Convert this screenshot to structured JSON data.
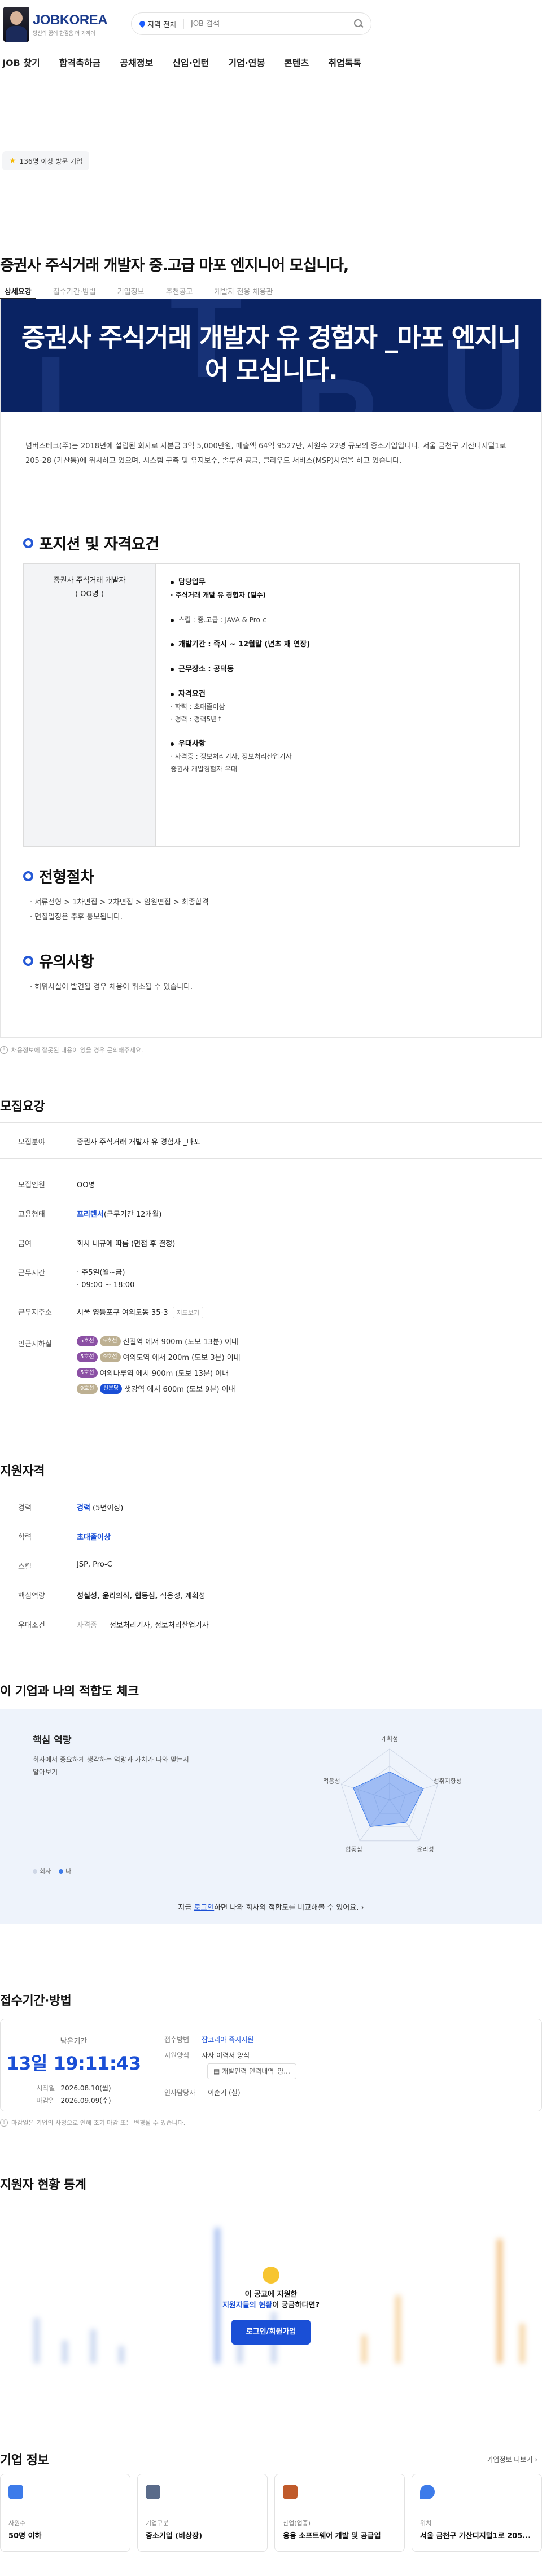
{
  "header": {
    "logo": {
      "title": "JOBKOREA",
      "subtitle": "당신의 꿈에 한걸음 더 가까이"
    },
    "search": {
      "location": "지역 전체",
      "placeholder": "JOB 검색"
    },
    "nav": [
      "JOB 찾기",
      "합격축하금",
      "공채정보",
      "신입·인턴",
      "기업·연봉",
      "콘텐츠",
      "취업톡톡"
    ]
  },
  "badge": {
    "label": "136명 이상 방문 기업"
  },
  "job": {
    "title": "증권사 주식거래 개발자 중.고급 마포 엔지니어 모십니다,",
    "tabs": [
      "상세요강",
      "접수기간·방법",
      "기업정보",
      "추천공고",
      "개발자 전용 채용관"
    ],
    "banner_title": "증권사 주식거래 개발자 유 경험자 _마포 엔지니어 모십니다.",
    "intro": "넘버스테크(주)는 2018년에 설립된 회사로 자본금 3억 5,000만원, 매출액 64억 9527만, 사원수 22명 규모의 중소기업입니다. 서울 금천구 가산디지털1로 205-28 (가산동)에 위치하고 있으며, 시스템 구축 및 유지보수, 솔루션 공급, 클라우드 서비스(MSP)사업을 하고 있습니다."
  },
  "position": {
    "heading": "포지션 및 자격요건",
    "left_title": "증권사 주식거래 개발자",
    "left_count": "( OO명 )",
    "blocks": [
      {
        "head": "담당업무",
        "lines": [
          "· 주식거래 개발 유 경험자 (필수)"
        ]
      },
      {
        "head": "스킬 : 중.고급 : JAVA & Pro-c",
        "lines": []
      },
      {
        "head": "개발기간 : 즉시 ~ 12월말 (년초 재 연장)",
        "lines": []
      },
      {
        "head": "근무장소 : 공덕동",
        "lines": []
      },
      {
        "head": "자격요건",
        "lines": [
          "· 학력 : 초대졸이상",
          "· 경력 : 경력5년↑"
        ]
      },
      {
        "head": "우대사항",
        "lines": [
          "· 자격증 : 정보처리기사, 정보처리산업기사",
          "  증권사 개발경험자 우대"
        ]
      }
    ]
  },
  "process": {
    "heading": "전형절차",
    "lines": [
      "· 서류전형 > 1차면접 > 2차면접 > 임원면접 > 최종합격",
      "· 면접일정은 추후 통보됩니다."
    ]
  },
  "notice": {
    "heading": "유의사항",
    "lines": [
      "· 허위사실이 발견될 경우 채용이 취소될 수 있습니다."
    ]
  },
  "footnote": "채용정보에 잘못된 내용이 있을 경우 문의해주세요.",
  "recruit": {
    "heading": "모집요강",
    "field_label": "모집분야",
    "field": "증권사 주식거래 개발자 유 경험자 _마포",
    "count_label": "모집인원",
    "count": "OO명",
    "type_label": "고용형태",
    "type_main": "프리랜서",
    "type_sub": "(근무기간 12개월)",
    "pay_label": "급여",
    "pay": "회사 내규에 따름 (면접 후 결정)",
    "hours_label": "근무시간",
    "hours": [
      "· 주5일(월~금)",
      "· 09:00 ~ 18:00"
    ],
    "addr_label": "근무지주소",
    "addr": "서울 영등포구 여의도동 35-3",
    "map_btn": "지도보기",
    "station_label": "인근지하철",
    "stations": [
      {
        "lines": [
          "5호선",
          "9호선"
        ],
        "colors": [
          "#8b50a4",
          "#bdb092"
        ],
        "text": "신길역 에서 900m (도보 13분) 이내"
      },
      {
        "lines": [
          "5호선",
          "9호선"
        ],
        "colors": [
          "#8b50a4",
          "#bdb092"
        ],
        "text": "여의도역 에서 200m (도보 3분) 이내"
      },
      {
        "lines": [
          "5호선"
        ],
        "colors": [
          "#8b50a4"
        ],
        "text": "여의나루역 에서 900m (도보 13분) 이내"
      },
      {
        "lines": [
          "9호선",
          "신분당"
        ],
        "colors": [
          "#bdb092",
          "#1a4fd6"
        ],
        "text": "샛강역 에서 600m (도보 9분) 이내"
      }
    ]
  },
  "qual": {
    "heading": "지원자격",
    "rows": [
      {
        "k": "경력",
        "v_blue": "경력",
        "v": " (5년이상)"
      },
      {
        "k": "학력",
        "v_blue": "초대졸이상",
        "v": ""
      },
      {
        "k": "스킬",
        "v_blue": "",
        "v": "JSP, Pro-C"
      },
      {
        "k": "핵심역량",
        "v_bold": "성실성, 윤리의식, 협동심,",
        "v": " 적응성, 계획성"
      },
      {
        "k": "우대조건",
        "v_gray": "자격증",
        "v": "정보처리기사, 정보처리산업기사"
      }
    ]
  },
  "fit": {
    "heading": "이 기업과 나의 적합도 체크",
    "card_title": "핵심 역량",
    "desc": "회사에서 중요하게 생각하는 역량과 가치가 나와 맞는지 알아보기",
    "axes": [
      "계획성",
      "성취지향성",
      "윤리성",
      "협동심",
      "적응성"
    ],
    "values_company": [
      0.55,
      0.7,
      0.55,
      0.65,
      0.75
    ],
    "legend": [
      "회사",
      "나"
    ],
    "cta_pre": "지금 ",
    "cta_link": "로그인",
    "cta_post": "하면 나와 회사의 적합도를 비교해볼 수 있어요."
  },
  "receipt": {
    "heading": "접수기간·방법",
    "remain_label": "남은기간",
    "remain": "13일 19:11:43",
    "start_label": "시작일",
    "start": "2026.08.10(월)",
    "end_label": "마감일",
    "end": "2026.09.09(수)",
    "method_label": "접수방법",
    "method": "잡코리아 즉시지원",
    "form_label": "지원양식",
    "form": "자사 이력서 양식",
    "file_btn": "개발인력 인력내역_양...",
    "manager_label": "인사담당자",
    "manager": "이순기 (실)",
    "note": "마감일은 기업의 사정으로 인해 조기 마감 또는 변경될 수 있습니다."
  },
  "stats": {
    "heading": "지원자 현황 통계",
    "overlay_line1": "이 공고에 지원한",
    "overlay_blue": "지원자들의 현황",
    "overlay_line2_post": "이 궁금하다면?",
    "btn": "로그인/회원가입"
  },
  "company": {
    "heading": "기업 정보",
    "more": "기업정보 더보기",
    "cards": [
      {
        "icon": "people-icon",
        "k": "사원수",
        "v": "50명 이하",
        "color": "#3d7bea"
      },
      {
        "icon": "building-icon",
        "k": "기업구분",
        "v": "중소기업 (비상장)",
        "color": "#5a6b8a"
      },
      {
        "icon": "briefcase-icon",
        "k": "산업(업종)",
        "v": "응용 소프트웨어 개발 및 공급업",
        "color": "#c05a2a"
      },
      {
        "icon": "location-icon",
        "k": "위치",
        "v": "서울 금천구 가산디지털1로 205...",
        "color": "#3d7bea"
      }
    ]
  }
}
